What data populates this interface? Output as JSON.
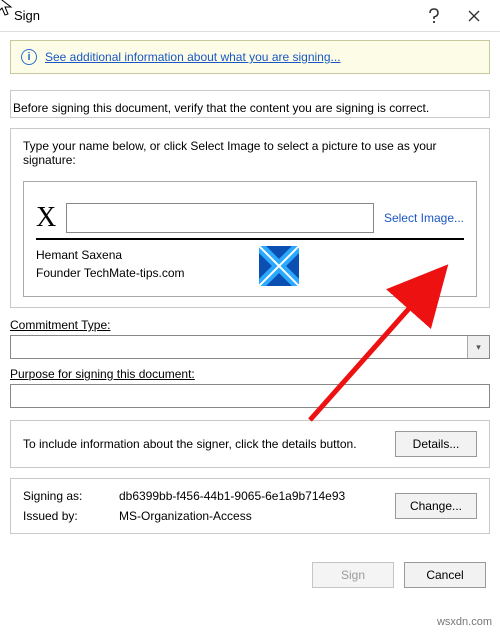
{
  "window": {
    "title": "Sign"
  },
  "infobar": {
    "link_text": "See additional information about what you are signing..."
  },
  "verify_text": "Before signing this document, verify that the content you are signing is correct.",
  "signature": {
    "instruction": "Type your name below, or click Select Image to select a picture to use as your signature:",
    "x_marker": "X",
    "select_image": "Select Image...",
    "signer_name": "Hemant Saxena",
    "signer_title": "Founder TechMate-tips.com"
  },
  "commitment": {
    "label": "Commitment Type:"
  },
  "purpose": {
    "label": "Purpose for signing this document:"
  },
  "details": {
    "text": "To include information about the signer, click the details button.",
    "button": "Details..."
  },
  "signing_as": {
    "label": "Signing as:",
    "value": "db6399bb-f456-44b1-9065-6e1a9b714e93",
    "issued_label": "Issued by:",
    "issued_value": "MS-Organization-Access",
    "change": "Change..."
  },
  "footer": {
    "sign": "Sign",
    "cancel": "Cancel"
  },
  "credit": "wsxdn.com"
}
